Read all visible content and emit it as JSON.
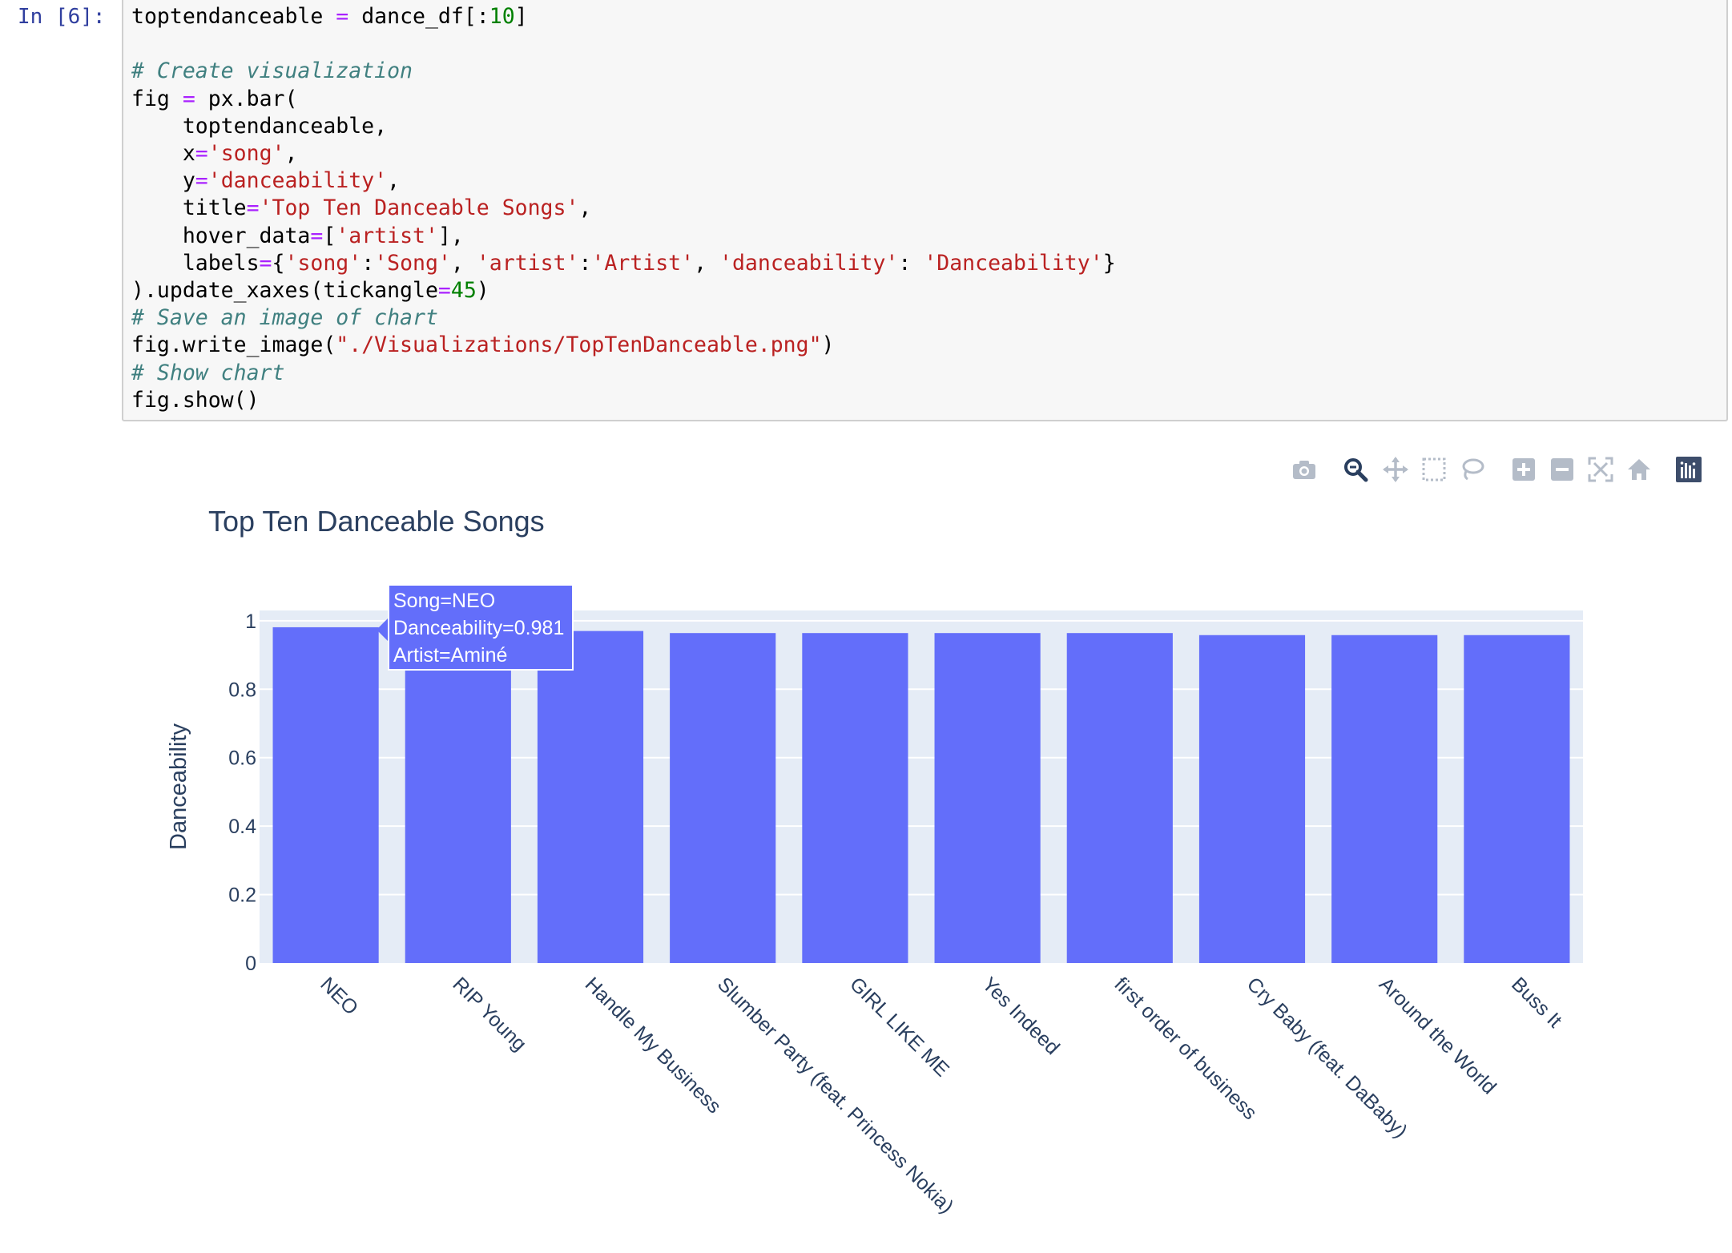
{
  "cell": {
    "prompt": "In [6]:",
    "code_lines": [
      [
        {
          "t": "toptendanceable ",
          "c": ""
        },
        {
          "t": "=",
          "c": "op"
        },
        {
          "t": " dance_df[:",
          "c": ""
        },
        {
          "t": "10",
          "c": "num"
        },
        {
          "t": "]",
          "c": ""
        }
      ],
      [],
      [
        {
          "t": "# Create visualization",
          "c": "cm"
        }
      ],
      [
        {
          "t": "fig ",
          "c": ""
        },
        {
          "t": "=",
          "c": "op"
        },
        {
          "t": " px.bar(",
          "c": ""
        }
      ],
      [
        {
          "t": "    toptendanceable,",
          "c": ""
        }
      ],
      [
        {
          "t": "    x",
          "c": ""
        },
        {
          "t": "=",
          "c": "op"
        },
        {
          "t": "'song'",
          "c": "str"
        },
        {
          "t": ",",
          "c": ""
        }
      ],
      [
        {
          "t": "    y",
          "c": ""
        },
        {
          "t": "=",
          "c": "op"
        },
        {
          "t": "'danceability'",
          "c": "str"
        },
        {
          "t": ",",
          "c": ""
        }
      ],
      [
        {
          "t": "    title",
          "c": ""
        },
        {
          "t": "=",
          "c": "op"
        },
        {
          "t": "'Top Ten Danceable Songs'",
          "c": "str"
        },
        {
          "t": ",",
          "c": ""
        }
      ],
      [
        {
          "t": "    hover_data",
          "c": ""
        },
        {
          "t": "=",
          "c": "op"
        },
        {
          "t": "[",
          "c": ""
        },
        {
          "t": "'artist'",
          "c": "str"
        },
        {
          "t": "],",
          "c": ""
        }
      ],
      [
        {
          "t": "    labels",
          "c": ""
        },
        {
          "t": "=",
          "c": "op"
        },
        {
          "t": "{",
          "c": ""
        },
        {
          "t": "'song'",
          "c": "str"
        },
        {
          "t": ":",
          "c": ""
        },
        {
          "t": "'Song'",
          "c": "str"
        },
        {
          "t": ", ",
          "c": ""
        },
        {
          "t": "'artist'",
          "c": "str"
        },
        {
          "t": ":",
          "c": ""
        },
        {
          "t": "'Artist'",
          "c": "str"
        },
        {
          "t": ", ",
          "c": ""
        },
        {
          "t": "'danceability'",
          "c": "str"
        },
        {
          "t": ": ",
          "c": ""
        },
        {
          "t": "'Danceability'",
          "c": "str"
        },
        {
          "t": "}",
          "c": ""
        }
      ],
      [
        {
          "t": ").update_xaxes(tickangle",
          "c": ""
        },
        {
          "t": "=",
          "c": "op"
        },
        {
          "t": "45",
          "c": "num"
        },
        {
          "t": ")",
          "c": ""
        }
      ],
      [
        {
          "t": "# Save an image of chart",
          "c": "cm"
        }
      ],
      [
        {
          "t": "fig.write_image(",
          "c": ""
        },
        {
          "t": "\"./Visualizations/TopTenDanceable.png\"",
          "c": "str"
        },
        {
          "t": ")",
          "c": ""
        }
      ],
      [
        {
          "t": "# Show chart",
          "c": "cm"
        }
      ],
      [
        {
          "t": "fig.show()",
          "c": ""
        }
      ]
    ]
  },
  "toolbar": {
    "buttons": [
      "camera-icon",
      "zoom-icon",
      "pan-icon",
      "box-select-icon",
      "lasso-select-icon",
      "zoom-in-icon",
      "zoom-out-icon",
      "autoscale-icon",
      "reset-axes-icon",
      "plotly-logo-icon"
    ],
    "active_color": "#2a3f5f",
    "inactive_color": "#b4bcc8"
  },
  "chart_data": {
    "type": "bar",
    "title": "Top Ten Danceable Songs",
    "xlabel": "",
    "ylabel": "Danceability",
    "categories": [
      "NEO",
      "RIP Young",
      "Handle My Business",
      "Slumber Party (feat. Princess Nokia)",
      "GIRL LIKE ME",
      "Yes Indeed",
      "first order of business",
      "Cry Baby (feat. DaBaby)",
      "Around the World",
      "Buss It"
    ],
    "values": [
      0.981,
      0.97,
      0.97,
      0.964,
      0.964,
      0.964,
      0.964,
      0.958,
      0.958,
      0.958
    ],
    "ylim": [
      0,
      1.03
    ],
    "yticks": [
      0,
      0.2,
      0.4,
      0.6,
      0.8,
      1
    ],
    "ytick_labels": [
      "0",
      "0.2",
      "0.4",
      "0.6",
      "0.8",
      "1"
    ],
    "tick_angle": 45,
    "grid": true,
    "bar_color": "#636efa",
    "plot_bg": "#e5ecf6",
    "tooltip": {
      "lines": [
        "Song=NEO",
        "Danceability=0.981",
        "Artist=Aminé"
      ]
    }
  }
}
